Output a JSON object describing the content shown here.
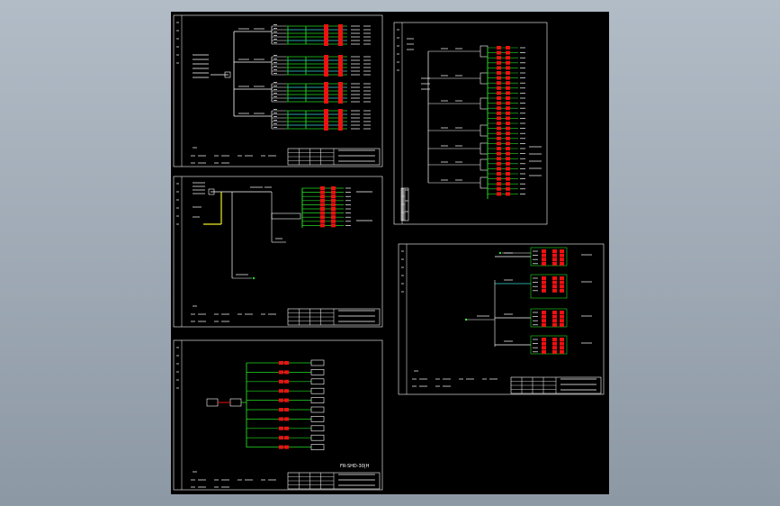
{
  "viewer": {
    "background_top": "#b2bcc7",
    "background_bottom": "#8c98a4",
    "canvas_color": "#000000"
  },
  "palette": {
    "frame": "#ffffff",
    "wire_green": "#22dd22",
    "wire_cyan": "#33dddd",
    "wire_yellow": "#eeee22",
    "breaker_red": "#ee1111"
  },
  "sheets": [
    {
      "id": "sheet-1",
      "kind": "multi-branch distribution schematic",
      "branch_groups": 4,
      "outgoing_circuits": 24
    },
    {
      "id": "sheet-2",
      "kind": "distribution schematic",
      "outgoing_circuits": 10
    },
    {
      "id": "sheet-3",
      "kind": "radial schematic",
      "outgoing_circuits": 10
    },
    {
      "id": "sheet-4",
      "kind": "distribution schematic",
      "outgoing_circuits": 30
    },
    {
      "id": "sheet-5",
      "kind": "distribution schematic",
      "branch_groups": 4
    }
  ],
  "labels": {
    "sheet_3_title_note": "FR-SHD-30|H"
  }
}
